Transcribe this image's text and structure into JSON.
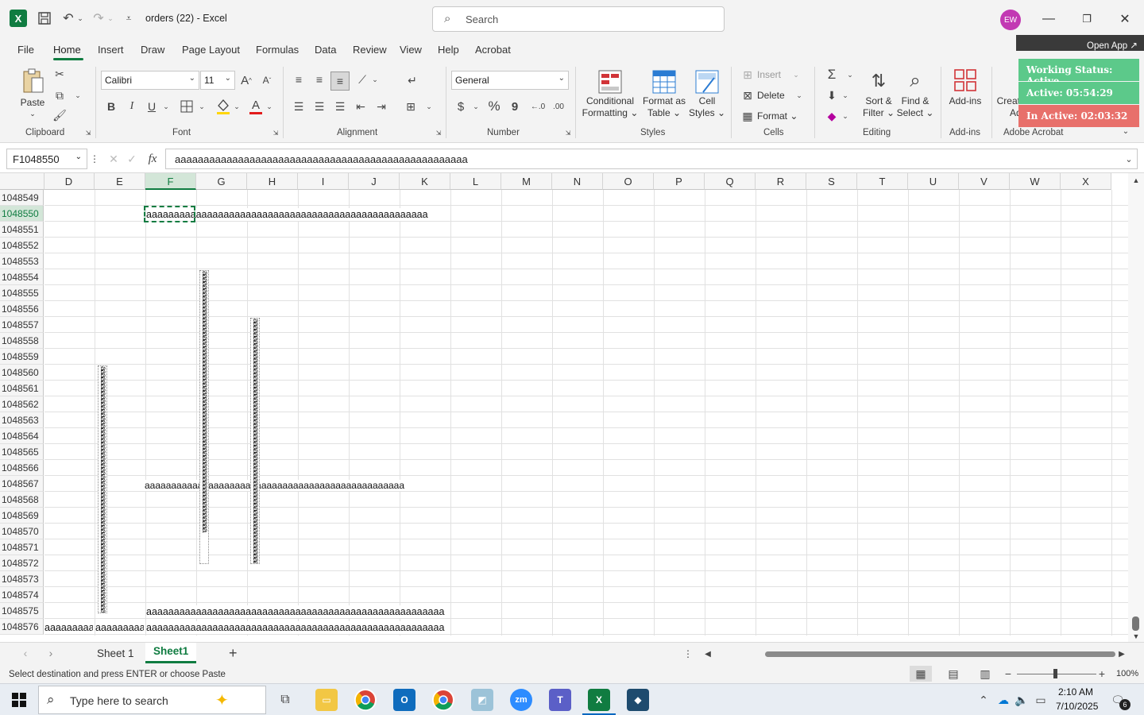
{
  "window": {
    "app_logo": "X",
    "title": "orders (22)  -  Excel",
    "search_placeholder": "Search",
    "user_initials": "EW"
  },
  "tabs": [
    "File",
    "Home",
    "Insert",
    "Draw",
    "Page Layout",
    "Formulas",
    "Data",
    "Review",
    "View",
    "Help",
    "Acrobat"
  ],
  "ribbon": {
    "clipboard": {
      "paste": "Paste",
      "label": "Clipboard"
    },
    "font": {
      "name": "Calibri",
      "size": "11",
      "label": "Font",
      "bold": "B",
      "italic": "I",
      "underline": "U",
      "grow": "A",
      "shrink": "A",
      "color_letter": "A"
    },
    "alignment": {
      "label": "Alignment"
    },
    "number": {
      "format": "General",
      "label": "Number",
      "currency": "$",
      "percent": "%",
      "comma": "9"
    },
    "styles": {
      "conditional": "Conditional",
      "conditional2": "Formatting",
      "format_table": "Format as",
      "format_table2": "Table",
      "cell_styles": "Cell",
      "cell_styles2": "Styles",
      "label": "Styles"
    },
    "cells": {
      "insert": "Insert",
      "delete": "Delete",
      "format": "Format",
      "label": "Cells"
    },
    "editing": {
      "sort": "Sort &",
      "sort2": "Filter",
      "find": "Find &",
      "find2": "Select",
      "label": "Editing"
    },
    "addins": {
      "addins": "Add-ins",
      "label": "Add-ins"
    },
    "acrobat": {
      "create": "Create and Share",
      "create2": "Adobe PDF",
      "label": "Adobe Acrobat"
    }
  },
  "overlay": {
    "open_app": "Open App ↗",
    "working_status": "Working Status: Active",
    "active": "Active: 05:54:29",
    "inactive": "In Active: 02:03:32",
    "colors": {
      "working": "#5cc98a",
      "active": "#5cc98a",
      "inactive": "#e8706b"
    }
  },
  "formula_bar": {
    "name_box": "F1048550",
    "fx": "fx",
    "value": "aaaaaaaaaaaaaaaaaaaaaaaaaaaaaaaaaaaaaaaaaaaaaaaaaaa"
  },
  "grid": {
    "columns": [
      "D",
      "E",
      "F",
      "G",
      "H",
      "I",
      "J",
      "K",
      "L",
      "M",
      "N",
      "O",
      "P",
      "Q",
      "R",
      "S",
      "T",
      "U",
      "V",
      "W",
      "X"
    ],
    "selected_column": "F",
    "rows": [
      "1048549",
      "1048550",
      "1048551",
      "1048552",
      "1048553",
      "1048554",
      "1048555",
      "1048556",
      "1048557",
      "1048558",
      "1048559",
      "1048560",
      "1048561",
      "1048562",
      "1048563",
      "1048564",
      "1048565",
      "1048566",
      "1048567",
      "1048568",
      "1048569",
      "1048570",
      "1048571",
      "1048572",
      "1048573",
      "1048574",
      "1048575",
      "1048576"
    ],
    "selected_row": "1048550",
    "cell_f1048550": "aaaaaaaaaaaaaaaaaaaaaaaaaaaaaaaaaaaaaaaaaaaaaaaaaaa",
    "cell_f1048567": "aaaaaaaaaaaaaaaaaaaaaaaaaaaaaaaaaaaaaaaaaaaaaaaaa",
    "cell_f1048575": "aaaaaaaaaaaaaaaaaaaaaaaaaaaaaaaaaaaaaaaaaaaaaaaaaaaaaa",
    "cell_d1048576": "aaaaaaaaaaaaaaaaaa",
    "cell_e1048576": "aaaaaaaaaaaaaaaaaa",
    "cell_f1048576": "aaaaaaaaaaaaaaaaaaaaaaaaaaaaaaaaaaaaaaaaaaaaaaaaaaaaaa",
    "vertical_text": "aaaaaaaaaaaaaaaaaaaaaaaaaaaaaaaaaaaaaaaaaaaaaaaaaaaaaaaaaaaaaaaaaaaaaaaa"
  },
  "sheets": {
    "tabs": [
      "Sheet 1",
      "Sheet1"
    ],
    "active": "Sheet1",
    "add": "+"
  },
  "status_bar": {
    "message": "Select destination and press ENTER or choose Paste",
    "zoom": "100%"
  },
  "taskbar": {
    "search_placeholder": "Type here to search",
    "time": "2:10 AM",
    "date": "7/10/2025",
    "notifications": "6"
  }
}
